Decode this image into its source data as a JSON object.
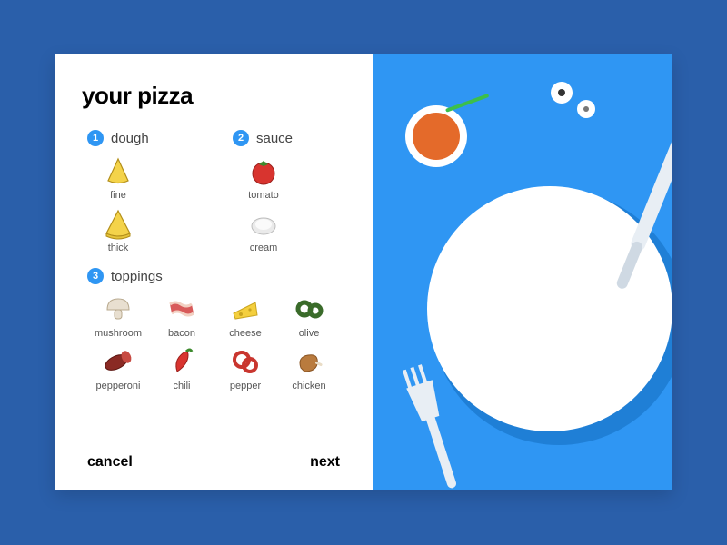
{
  "title": "your pizza",
  "sections": {
    "dough": {
      "num": "1",
      "label": "dough",
      "options": [
        "fine",
        "thick"
      ]
    },
    "sauce": {
      "num": "2",
      "label": "sauce",
      "options": [
        "tomato",
        "cream"
      ]
    },
    "toppings": {
      "num": "3",
      "label": "toppings",
      "options": [
        "mushroom",
        "bacon",
        "cheese",
        "olive",
        "pepperoni",
        "chili",
        "pepper",
        "chicken"
      ]
    }
  },
  "buttons": {
    "cancel": "cancel",
    "next": "next"
  }
}
